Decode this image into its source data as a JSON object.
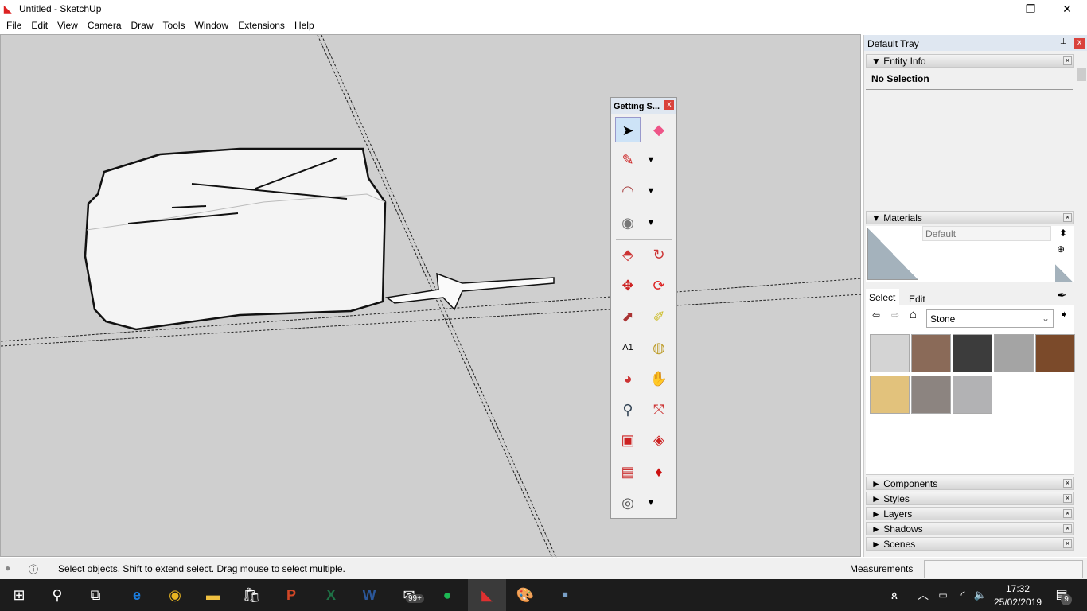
{
  "window": {
    "title": "Untitled - SketchUp",
    "minimize": "—",
    "maximize": "❐",
    "close": "✕"
  },
  "menu": [
    "File",
    "Edit",
    "View",
    "Camera",
    "Draw",
    "Tools",
    "Window",
    "Extensions",
    "Help"
  ],
  "toolbar": {
    "title": "Getting S...",
    "close": "x",
    "tools": [
      "select-icon",
      "eraser-icon",
      "pencil-icon",
      "arc-icon",
      "circle-icon",
      "push-pull-icon",
      "follow-me-icon",
      "move-icon",
      "rotate-icon",
      "scale-icon",
      "tape-measure-icon",
      "text-icon",
      "paint-bucket-icon",
      "orbit-icon",
      "pan-icon",
      "zoom-icon",
      "zoom-extents-icon",
      "warehouse-icon",
      "extension-warehouse-icon",
      "layout-icon",
      "ruby-icon",
      "account-icon"
    ]
  },
  "tray": {
    "title": "Default Tray",
    "pin": "📌",
    "close": "x",
    "entity_info": {
      "label": "Entity Info",
      "status": "No Selection"
    },
    "materials": {
      "label": "Materials",
      "name_placeholder": "Default",
      "tab_select": "Select",
      "tab_edit": "Edit",
      "collection": "Stone",
      "swatches": [
        "#d4d4d4",
        "#8a6a58",
        "#3c3c3c",
        "#a4a4a4",
        "#7b4a2a",
        "#e2c27c",
        "#8c8480",
        "#b2b2b4"
      ]
    },
    "collapsed": [
      "Components",
      "Styles",
      "Layers",
      "Shadows",
      "Scenes"
    ]
  },
  "status": {
    "message": "Select objects. Shift to extend select. Drag mouse to select multiple.",
    "measurements_label": "Measurements",
    "measurements_value": ""
  },
  "taskbar": {
    "time": "17:32",
    "date": "25/02/2019",
    "mail_badge": "99+",
    "notifications": "9"
  }
}
